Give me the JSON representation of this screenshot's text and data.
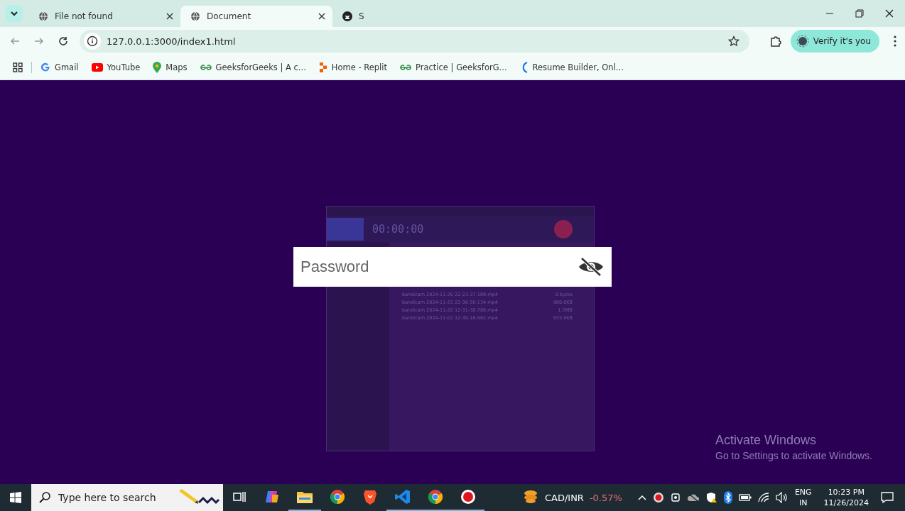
{
  "browser": {
    "tabs": [
      {
        "title": "File not found",
        "selected": false
      },
      {
        "title": "Document",
        "selected": true
      },
      {
        "title": "S",
        "selected": false
      }
    ],
    "url": "127.0.0.1:3000/index1.html",
    "profile_button": "Verify it's you",
    "bookmarks": [
      {
        "label": "Gmail"
      },
      {
        "label": "YouTube"
      },
      {
        "label": "Maps"
      },
      {
        "label": "GeeksforGeeks | A c..."
      },
      {
        "label": "Home - Replit"
      },
      {
        "label": "Practice | GeeksforG..."
      },
      {
        "label": "Resume Builder, Onl..."
      }
    ]
  },
  "page": {
    "password_field": {
      "placeholder": "Password"
    }
  },
  "recorder": {
    "timer": "00:00:00",
    "files": [
      {
        "name": "bandicam 2024-11-26 22-23-37-109.mp4",
        "size": "0 bytes"
      },
      {
        "name": "bandicam 2024-11-25 22-36-56-134.mp4",
        "size": "980.6KB"
      },
      {
        "name": "bandicam 2024-11-20 12-31-38-786.mp4",
        "size": "1.5MB"
      },
      {
        "name": "bandicam 2024-11-02 12-30-18-962.mp4",
        "size": "933.9KB"
      }
    ]
  },
  "activation": {
    "title": "Activate Windows",
    "subtitle": "Go to Settings to activate Windows."
  },
  "taskbar": {
    "search_placeholder": "Type here to search",
    "apps": [
      {
        "kind": "taskview",
        "active": false
      },
      {
        "kind": "copilot",
        "active": false
      },
      {
        "kind": "folder",
        "active": true
      },
      {
        "kind": "chrome",
        "active": false
      },
      {
        "kind": "brave",
        "active": false
      },
      {
        "kind": "vscode",
        "active": true
      },
      {
        "kind": "chrome",
        "active": true
      },
      {
        "kind": "record",
        "active": true
      }
    ],
    "ticker": {
      "symbol": "CAD/INR",
      "change": "-0.57%"
    },
    "language": "ENG",
    "region": "IN",
    "time": "10:23 PM",
    "date": "11/26/2024"
  }
}
